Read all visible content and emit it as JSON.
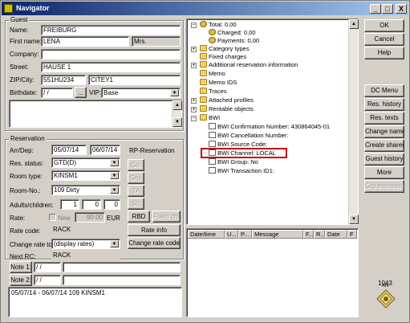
{
  "window": {
    "title": "Navigator",
    "controls": {
      "minimize": "_",
      "maximize": "□",
      "close": "X"
    }
  },
  "guest": {
    "group_title": "Guest",
    "name_label": "Name:",
    "name": "FREIBURG",
    "firstname_label": "First name:",
    "firstname": "LENA",
    "salutation": "Mrs.",
    "company_label": "Company:",
    "company": "",
    "street_label": "Street:",
    "street": "HAUSE 1",
    "zipcity_label": "ZIP/City:",
    "zip": "551HU234",
    "city": "CITEY1",
    "birthdate_label": "Birthdate:",
    "birthdate": "  /  /",
    "birthdate_btn": "...",
    "vip_label": "VIP:",
    "vip": "Base"
  },
  "reservation": {
    "group_title": "Reservation",
    "arrdep_label": "Arr/Dep:",
    "arrival": "05/07/14",
    "departure": "06/07/14",
    "status_label": "Res. status:",
    "status": "GTD(D)",
    "roomtype_label": "Room type:",
    "roomtype": "KINSM1",
    "roomno_label": "Room-No.:",
    "roomno": "109 Dirty",
    "adults_label": "Adults/children:",
    "adults": "1",
    "children1": "0",
    "children2": "0",
    "rate_label": "Rate:",
    "new_label": "New",
    "rate_value": "90.00",
    "currency": "EUR",
    "ratecode_label": "Rate code:",
    "ratecode": "RACK",
    "changerate_label": "Change rate to:",
    "changerate": "(display rates)",
    "nextrc_label": "Next RC:",
    "nextrc": "RACK",
    "rp_title": "RP-Reservation",
    "rp_buttons": [
      "Co.",
      "Grp.",
      "TA",
      "Sc."
    ],
    "rbd": "RBD",
    "fixed_ch": "Fixed ch.",
    "rate_info": "Rate info",
    "change_rate_code": "Change rate code"
  },
  "notes": {
    "note1_label": "Note 1:",
    "note1_date": "  /  /",
    "note2_label": "Note 2:",
    "note2_date": "  /  /"
  },
  "summary": {
    "line": "05/07/14 - 06/07/14   109 KINSM1"
  },
  "tree": {
    "total": "Total: 0,00",
    "charged": "Charged: 0,00",
    "payments": "Payments: 0,00",
    "items": [
      "Category types",
      "Fixed charges",
      "Additional reservation information",
      "Memo",
      "Memo IDS",
      "Traces",
      "Attached profiles",
      "Rentable objects",
      "BWI"
    ],
    "bwi_children": [
      "BWI Confirmation Number: 430864045-01",
      "BWI Cancellation Number:",
      "BWI Source Code:",
      "BWI Channel: LOCAL",
      "BWI Group: No",
      "BWI Transaction ID1:"
    ]
  },
  "messages": {
    "columns": [
      "Date/time",
      "U...",
      "P...",
      "Message",
      "F...",
      "R...",
      "Date",
      "F"
    ]
  },
  "sidebar": {
    "buttons_top": [
      "OK",
      "Cancel",
      "Help"
    ],
    "buttons_mid": [
      "DC Menu",
      "Res. history",
      "Res. texts",
      "Change name",
      "Create sharer",
      "Guest history",
      "More",
      "Grp members"
    ],
    "counter": "1043",
    "logo_text": "AN"
  },
  "colors": {
    "highlight_box": "#c00000",
    "title_start": "#0a246a",
    "title_end": "#a6caf0"
  }
}
